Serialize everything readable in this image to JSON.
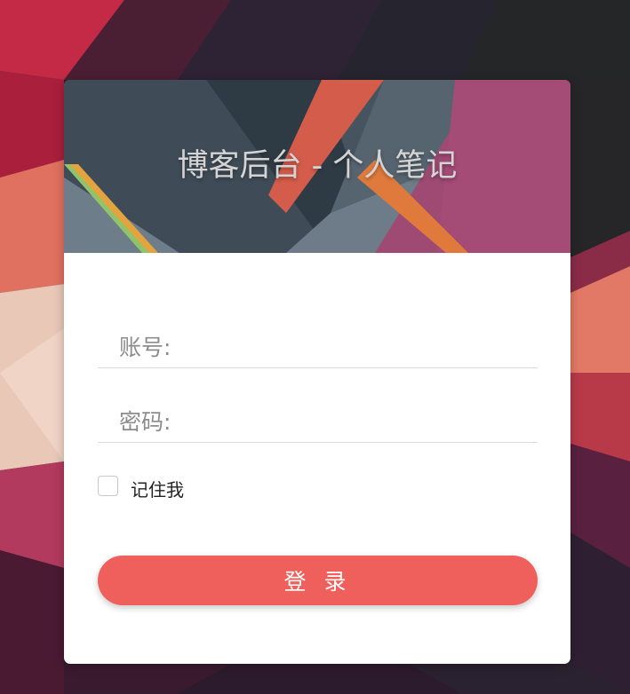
{
  "banner": {
    "title": "博客后台 - 个人笔记"
  },
  "form": {
    "account_label": "账号:",
    "account_value": "",
    "password_label": "密码:",
    "password_value": "",
    "remember_label": "记住我",
    "remember_checked": false,
    "login_label": "登 录"
  },
  "colors": {
    "button": "#ef5f5c",
    "page_background": "#242628",
    "card": "#ffffff"
  }
}
